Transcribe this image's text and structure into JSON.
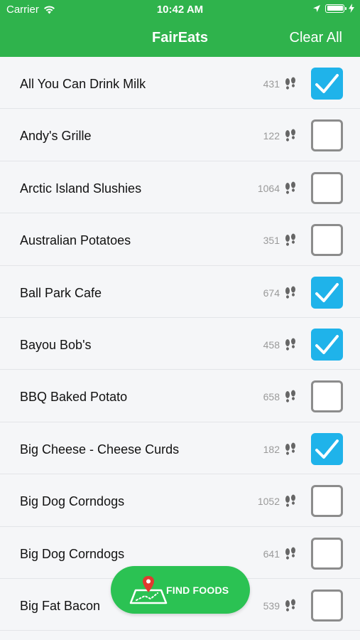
{
  "status_bar": {
    "carrier": "Carrier",
    "time": "10:42 AM"
  },
  "nav": {
    "title": "FairEats",
    "clear_all": "Clear All"
  },
  "items": [
    {
      "name": "All You Can Drink Milk",
      "steps": "431",
      "checked": true
    },
    {
      "name": "Andy's Grille",
      "steps": "122",
      "checked": false
    },
    {
      "name": "Arctic Island Slushies",
      "steps": "1064",
      "checked": false
    },
    {
      "name": "Australian Potatoes",
      "steps": "351",
      "checked": false
    },
    {
      "name": "Ball Park Cafe",
      "steps": "674",
      "checked": true
    },
    {
      "name": "Bayou Bob's",
      "steps": "458",
      "checked": true
    },
    {
      "name": "BBQ Baked Potato",
      "steps": "658",
      "checked": false
    },
    {
      "name": "Big Cheese - Cheese Curds",
      "steps": "182",
      "checked": true
    },
    {
      "name": "Big Dog Corndogs",
      "steps": "1052",
      "checked": false
    },
    {
      "name": "Big Dog Corndogs",
      "steps": "641",
      "checked": false
    },
    {
      "name": "Big Fat Bacon",
      "steps": "539",
      "checked": false
    }
  ],
  "fab": {
    "label": "FIND FOODS"
  },
  "colors": {
    "header": "#2fb34c",
    "check": "#1fb3ea",
    "fab": "#2bc253"
  }
}
